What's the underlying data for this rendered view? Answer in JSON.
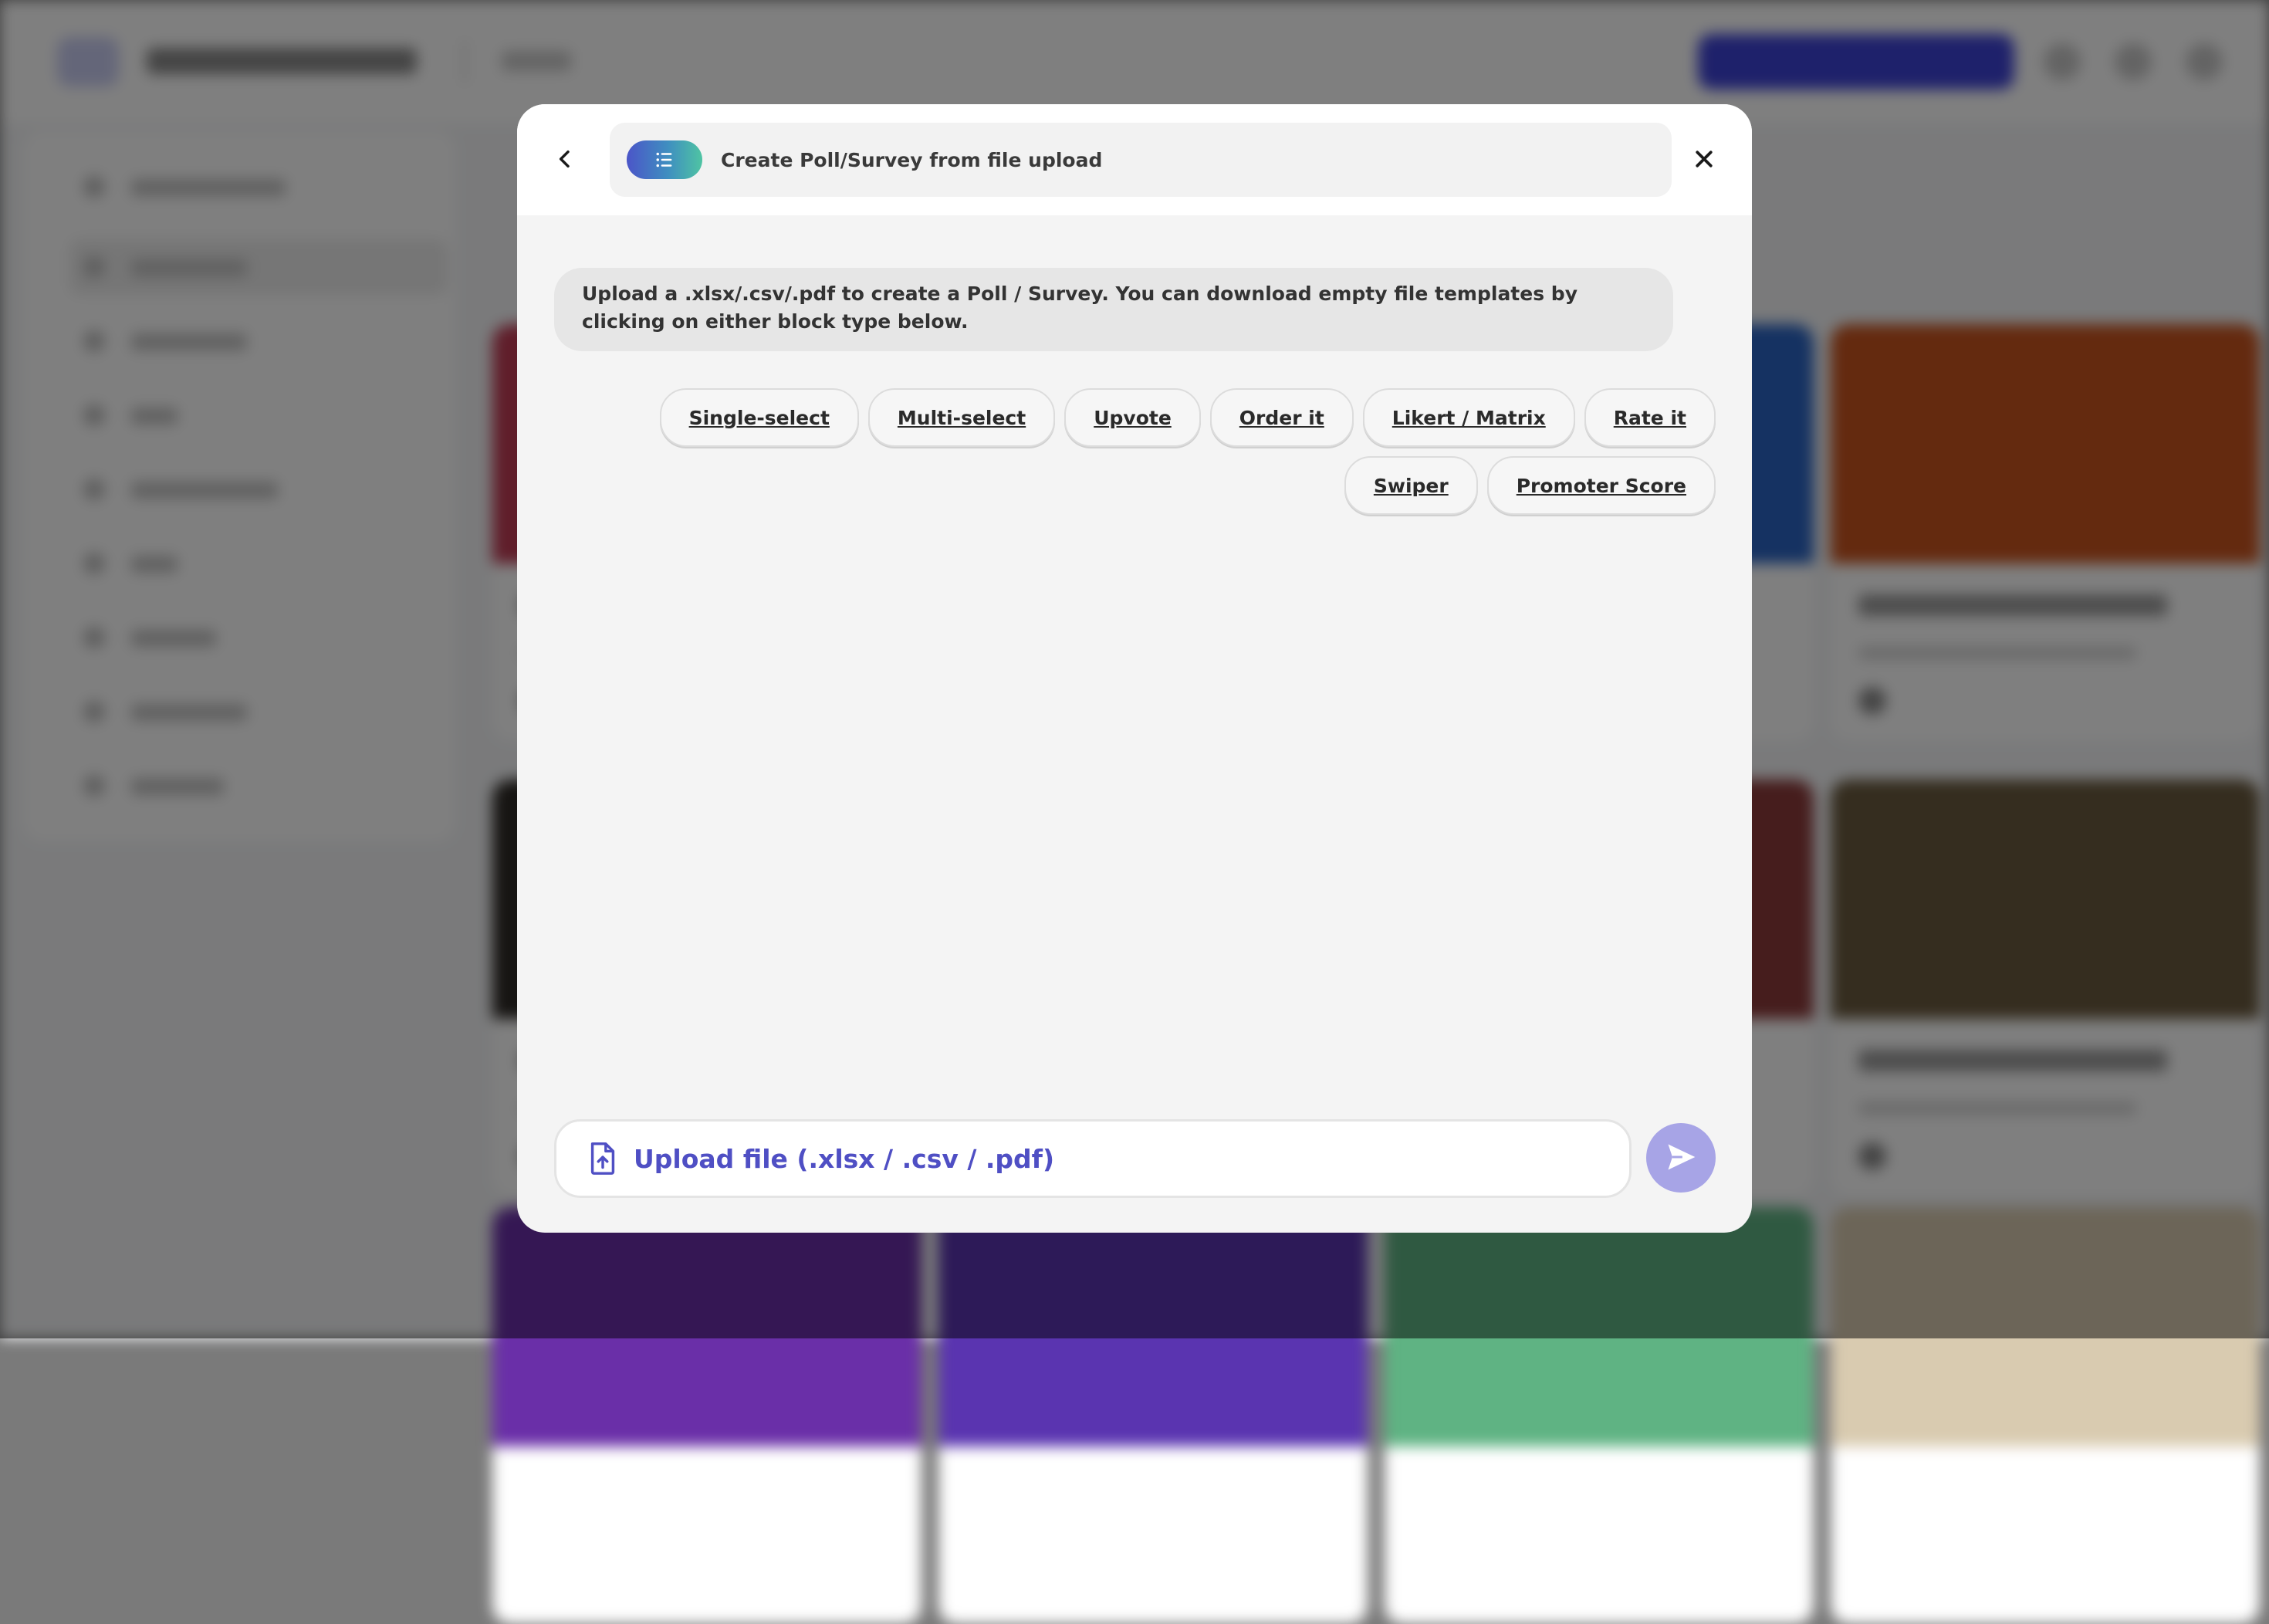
{
  "modal": {
    "title": "Create Poll/Survey from file upload",
    "info_text": "Upload a .xlsx/.csv/.pdf to create a Poll / Survey. You can download empty file templates by clicking on either block type below.",
    "block_types": [
      {
        "label": "Single-select"
      },
      {
        "label": "Multi-select"
      },
      {
        "label": "Upvote"
      },
      {
        "label": "Order it"
      },
      {
        "label": "Likert / Matrix"
      },
      {
        "label": "Rate it"
      },
      {
        "label": "Swiper"
      },
      {
        "label": "Promoter Score"
      }
    ],
    "upload_label": "Upload file (.xlsx / .csv / .pdf)",
    "icons": {
      "back": "chevron-left-icon",
      "close": "close-icon",
      "title": "list-icon",
      "upload": "file-upload-icon",
      "send": "send-icon"
    }
  },
  "colors": {
    "accent": "#4f4fc4",
    "send_button": "#a7a4e6",
    "title_gradient_start": "#4b55c8",
    "title_gradient_end": "#4fc4a3"
  }
}
